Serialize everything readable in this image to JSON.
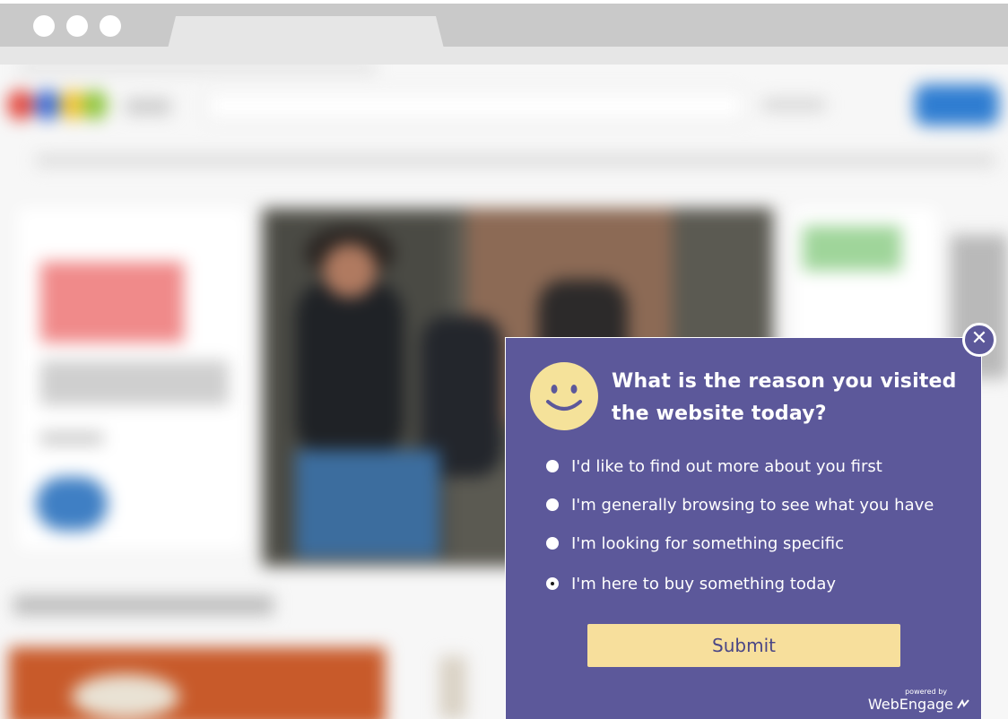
{
  "colors": {
    "popup_bg": "#5c589a",
    "submit_bg": "#f7df9c",
    "submit_text": "#4a4686",
    "smiley": "#f5e29a"
  },
  "browser": {
    "window_buttons": [
      "dot",
      "dot",
      "dot"
    ]
  },
  "survey": {
    "close_icon": "close-icon",
    "smiley_icon": "smiley-face-icon",
    "question": "What is the reason you visited the website today?",
    "options": [
      {
        "label": "I'd like to find out more about you first",
        "selected": false
      },
      {
        "label": "I'm generally browsing to see what you have",
        "selected": false
      },
      {
        "label": "I'm looking for something specific",
        "selected": false
      },
      {
        "label": "I'm here to buy something today",
        "selected": true
      }
    ],
    "submit_label": "Submit",
    "powered_by": "powered by",
    "brand": "WebEngage"
  }
}
